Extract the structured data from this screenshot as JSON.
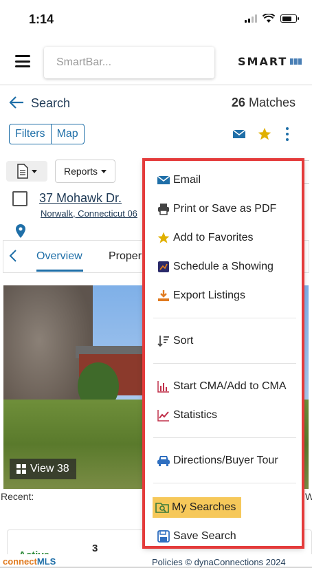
{
  "status": {
    "time": "1:14"
  },
  "header": {
    "smartbar_placeholder": "SmartBar...",
    "logo_text": "SMART"
  },
  "search": {
    "back_label": "Search",
    "match_count": "26",
    "match_label": "Matches"
  },
  "view_toggle": {
    "filters": "Filters",
    "map": "Map"
  },
  "reports": {
    "label": "Reports"
  },
  "listing": {
    "address": "37 Mohawk Dr.",
    "city": "Norwalk, Connecticut 06"
  },
  "tabs": {
    "overview": "Overview",
    "property": "Proper"
  },
  "photo": {
    "view_label": "View 38"
  },
  "recent": {
    "label": "Recent:",
    "trailing": "W"
  },
  "stats": {
    "value_3": "3",
    "status_partial": "Active"
  },
  "footer": {
    "brand_prefix": "connect",
    "brand_suffix": "MLS",
    "links": "Policies   © dynaConnections 2024"
  },
  "menu": {
    "items": [
      {
        "label": "Email",
        "icon": "envelope-icon"
      },
      {
        "label": "Print or Save as PDF",
        "icon": "printer-icon"
      },
      {
        "label": "Add to Favorites",
        "icon": "star-icon"
      },
      {
        "label": "Schedule a Showing",
        "icon": "calendar-icon"
      },
      {
        "label": "Export Listings",
        "icon": "download-icon"
      },
      {
        "label": "Sort",
        "icon": "sort-icon"
      },
      {
        "label": "Start CMA/Add to CMA",
        "icon": "bar-chart-icon"
      },
      {
        "label": "Statistics",
        "icon": "line-chart-icon"
      },
      {
        "label": "Directions/Buyer Tour",
        "icon": "car-icon"
      },
      {
        "label": "My Searches",
        "icon": "folder-search-icon"
      },
      {
        "label": "Save Search",
        "icon": "save-icon"
      }
    ]
  },
  "colors": {
    "accent": "#1f6fa8",
    "highlight": "#f6c85a",
    "annotation": "#e43b3b",
    "star": "#e0b000"
  }
}
